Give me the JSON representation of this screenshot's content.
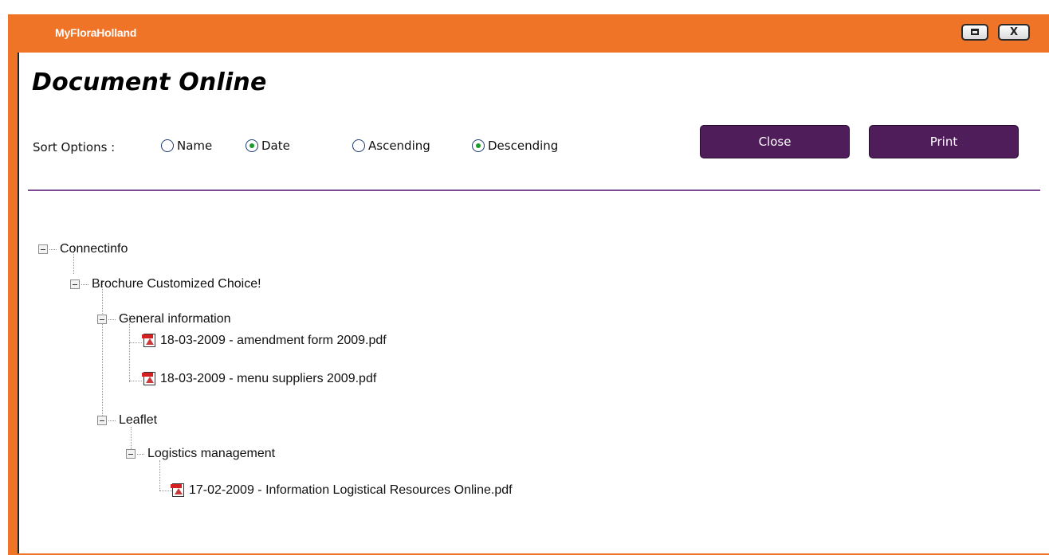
{
  "window": {
    "title": "MyFloraHolland",
    "accent_color": "#f07427",
    "controls": {
      "restore_icon": "restore-icon",
      "close_icon": "close-icon",
      "close_glyph": "X"
    }
  },
  "page": {
    "title": "Document Online"
  },
  "sort": {
    "label": "Sort Options :",
    "by": [
      {
        "label": "Name",
        "checked": false
      },
      {
        "label": "Date",
        "checked": true
      }
    ],
    "order": [
      {
        "label": "Ascending",
        "checked": false
      },
      {
        "label": "Descending",
        "checked": true
      }
    ]
  },
  "buttons": {
    "close": "Close",
    "print": "Print",
    "button_color": "#4e1d5a"
  },
  "tree": [
    {
      "label": "Connectinfo",
      "type": "folder",
      "depth": 0
    },
    {
      "label": "Brochure Customized Choice!",
      "type": "folder",
      "depth": 1
    },
    {
      "label": "General information",
      "type": "folder",
      "depth": 2
    },
    {
      "label": "18-03-2009 - amendment form 2009.pdf",
      "type": "pdf",
      "depth": 3
    },
    {
      "label": "18-03-2009 - menu suppliers 2009.pdf",
      "type": "pdf",
      "depth": 3
    },
    {
      "label": "Leaflet",
      "type": "folder",
      "depth": 2
    },
    {
      "label": "Logistics management",
      "type": "folder",
      "depth": 3
    },
    {
      "label": "17-02-2009 - Information Logistical Resources Online.pdf",
      "type": "pdf",
      "depth": 4
    }
  ]
}
